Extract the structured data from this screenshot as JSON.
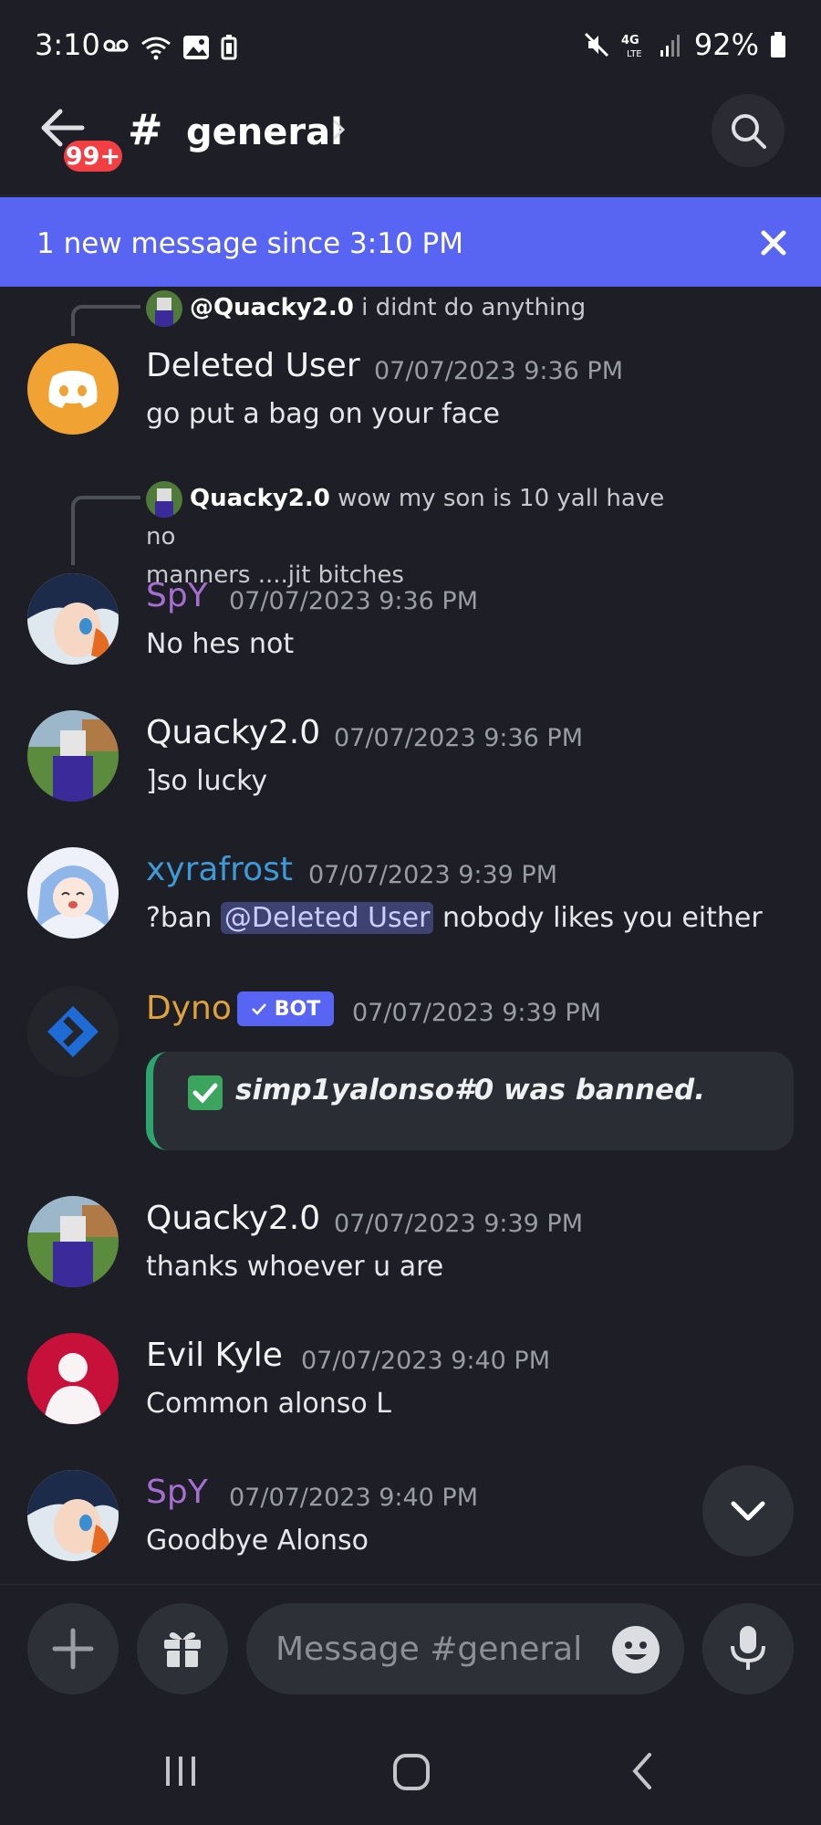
{
  "status": {
    "time": "3:10",
    "battery": "92%"
  },
  "header": {
    "unread_badge": "99+",
    "channel_name": "general"
  },
  "banner": {
    "text": "1 new message since 3:10 PM"
  },
  "messages": [
    {
      "reply_author": "@Quacky2.0",
      "reply_text": "i didnt do anything",
      "author": "Deleted User",
      "time": "07/07/2023 9:36 PM",
      "text": "go put a bag on your face",
      "name_color": "#f2f3f5"
    },
    {
      "reply_author": "Quacky2.0",
      "reply_text": "wow my son is 10 yall have no",
      "reply_text2": "manners ....jit bitches",
      "author": "SpY",
      "time": "07/07/2023 9:36 PM",
      "text": "No hes not",
      "name_color": "#a66ecf"
    },
    {
      "author": "Quacky2.0",
      "time": "07/07/2023 9:36 PM",
      "text": "]so lucky",
      "name_color": "#f2f3f5"
    },
    {
      "author": "xyrafrost",
      "time": "07/07/2023 9:39 PM",
      "text_pre": "?ban ",
      "mention": "@Deleted User",
      "text_post": " nobody likes you either",
      "name_color": "#3e9ad6"
    },
    {
      "author": "Dyno",
      "bot_tag": "BOT",
      "time": "07/07/2023 9:39 PM",
      "embed_text": "simp1yalonso#0 was banned.",
      "name_color": "#e0a33b"
    },
    {
      "author": "Quacky2.0",
      "time": "07/07/2023 9:39 PM",
      "text": "thanks whoever u are",
      "name_color": "#f2f3f5"
    },
    {
      "author": "Evil Kyle",
      "time": "07/07/2023 9:40 PM",
      "text": "Common alonso L",
      "name_color": "#f2f3f5"
    },
    {
      "author": "SpY",
      "time": "07/07/2023 9:40 PM",
      "text": "Goodbye Alonso",
      "name_color": "#a66ecf"
    }
  ],
  "composer": {
    "placeholder": "Message #general"
  },
  "colors": {
    "accent": "#5865f2",
    "background": "#1e1f26",
    "mention_bg": "#3d4270",
    "danger": "#f23f43",
    "success": "#2ea46e"
  }
}
